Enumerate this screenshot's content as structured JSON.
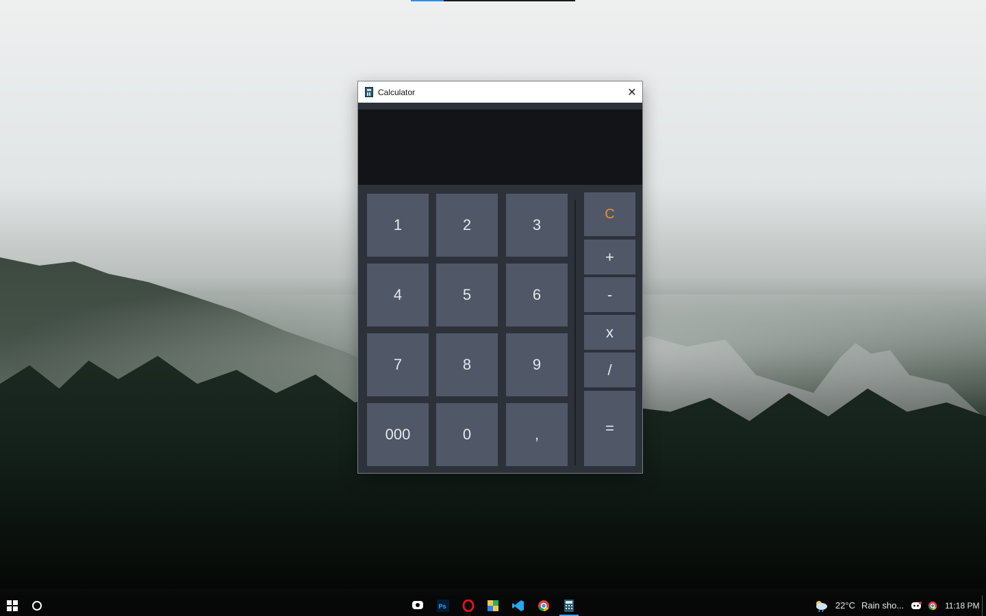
{
  "window": {
    "title": "Calculator",
    "close_glyph": "✕",
    "display_value": ""
  },
  "keys": {
    "k1": "1",
    "k2": "2",
    "k3": "3",
    "k4": "4",
    "k5": "5",
    "k6": "6",
    "k7": "7",
    "k8": "8",
    "k9": "9",
    "k000": "000",
    "k0": "0",
    "kcomma": ",",
    "clear": "C",
    "plus": "+",
    "minus": "-",
    "multiply": "x",
    "divide": "/",
    "equals": "="
  },
  "taskbar": {
    "weather_temp": "22°C",
    "weather_desc": "Rain sho...",
    "clock": "11:18 PM",
    "pinned_apps": [
      "chat-app",
      "photoshop",
      "opera",
      "sticky-app",
      "vscode",
      "chrome",
      "calculator"
    ]
  },
  "colors": {
    "window_bg": "#2d313a",
    "display_bg": "#131417",
    "key_bg": "#505766",
    "clear_accent": "#e8932e",
    "taskbar_active": "#4aa3e8"
  }
}
